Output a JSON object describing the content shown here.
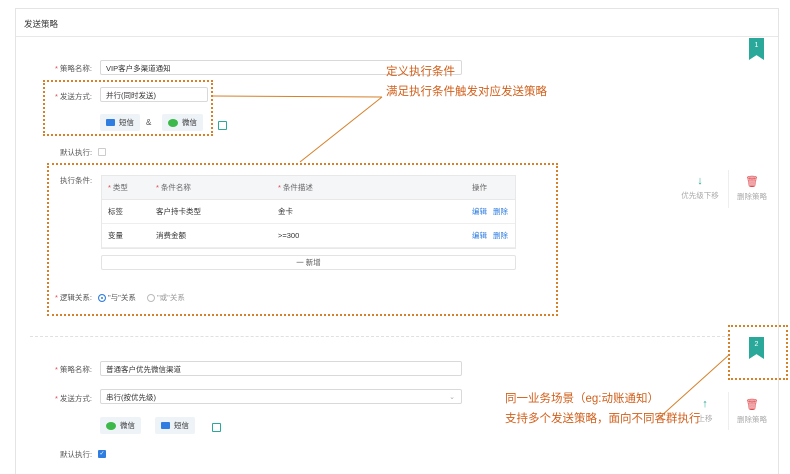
{
  "header": {
    "title": "发送策略"
  },
  "labels": {
    "policy_name": "策略名称:",
    "send_mode": "发送方式:",
    "default_exec": "默认执行:",
    "conditions": "执行条件:",
    "logic": "逻辑关系:"
  },
  "policy1": {
    "bookmark": "1",
    "name": "VIP客户多渠道通知",
    "mode": "并行(同时发送)",
    "channels": [
      "短信",
      "微信"
    ],
    "amp": "&",
    "table": {
      "headers": [
        "类型",
        "条件名称",
        "条件描述",
        "操作"
      ],
      "rows": [
        {
          "type": "标签",
          "name": "客户持卡类型",
          "desc": "金卡",
          "edit": "编辑",
          "del": "删除"
        },
        {
          "type": "变量",
          "name": "消费金额",
          "desc": ">=300",
          "edit": "编辑",
          "del": "删除"
        }
      ],
      "add": "一 新增"
    },
    "logic_and": "\"与\"关系",
    "logic_or": "\"或\"关系",
    "action_down": "优先级下移",
    "action_delete": "删除策略"
  },
  "policy2": {
    "bookmark": "2",
    "name": "普通客户优先微信渠道",
    "mode": "串行(按优先级)",
    "channels": [
      "微信",
      "短信"
    ],
    "action_up": "上移",
    "action_delete": "删除策略"
  },
  "annotations": {
    "a1": "定义执行条件",
    "a2": "满足执行条件触发对应发送策略",
    "a3": "同一业务场景（eg:动账通知）",
    "a4": "支持多个发送策略，面向不同客群执行"
  },
  "colors": {
    "accent": "#2f7de1",
    "annotation": "#d6802a",
    "bookmark": "#2aa89a",
    "required": "#e0474c"
  }
}
